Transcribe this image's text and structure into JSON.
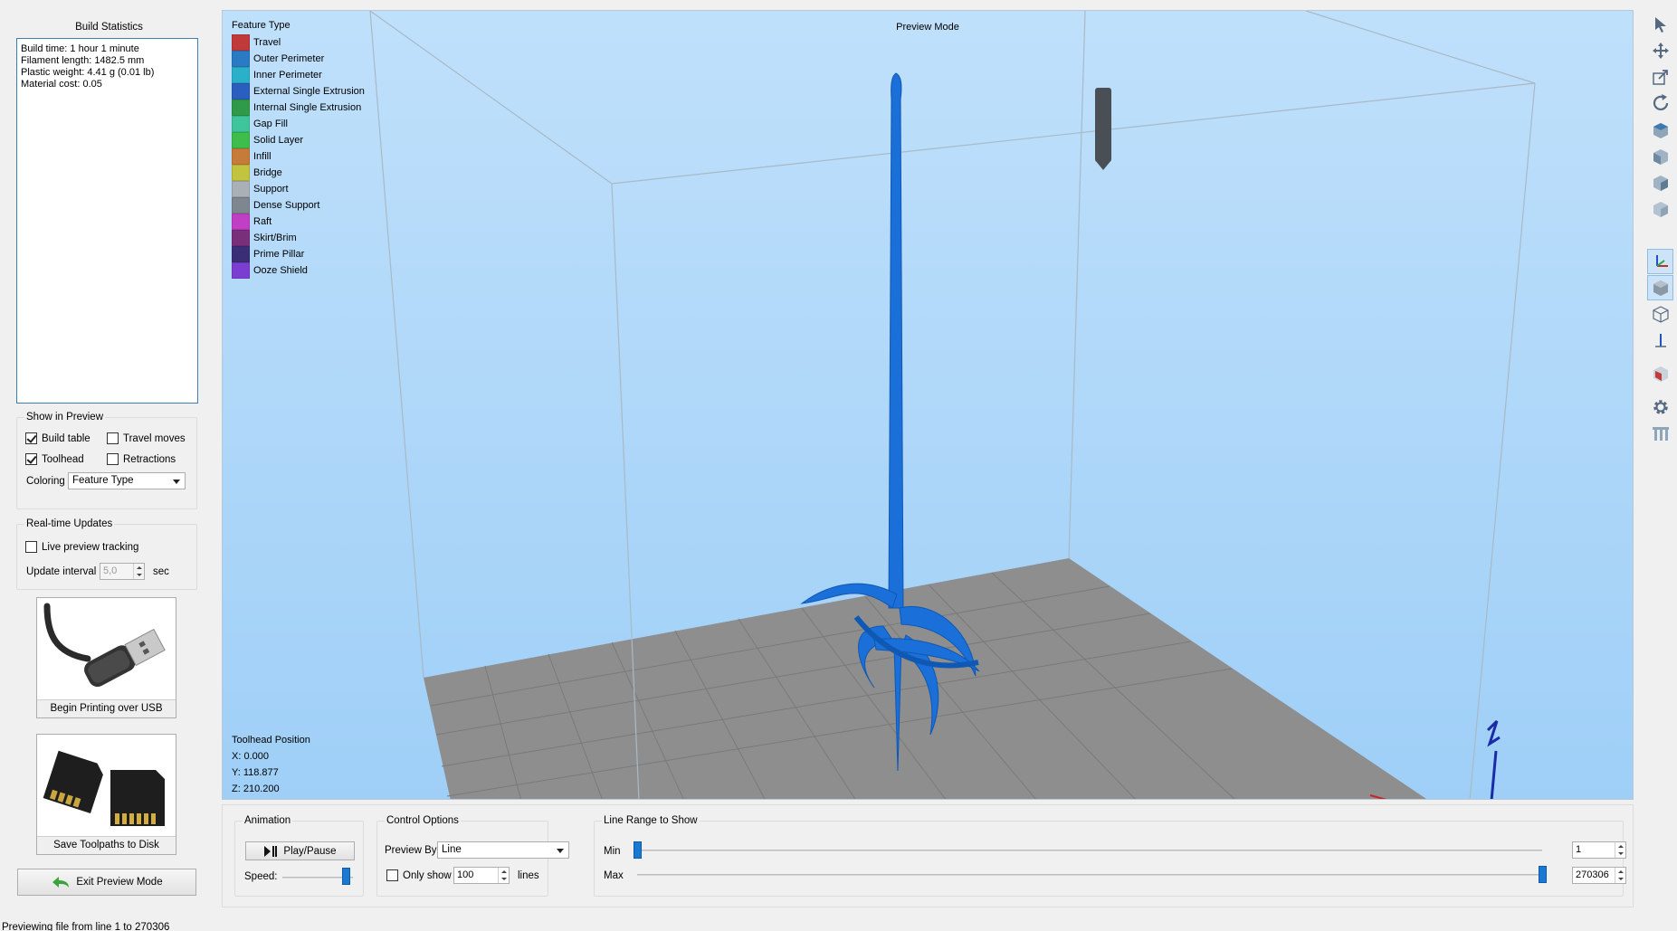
{
  "build_statistics": {
    "title": "Build Statistics",
    "lines": [
      "Build time: 1 hour 1 minute",
      "Filament length: 1482.5 mm",
      "Plastic weight: 4.41 g (0.01 lb)",
      "Material cost: 0.05"
    ]
  },
  "show_in_preview": {
    "title": "Show in Preview",
    "build_table": {
      "label": "Build table",
      "checked": true
    },
    "travel_moves": {
      "label": "Travel moves",
      "checked": false
    },
    "toolhead": {
      "label": "Toolhead",
      "checked": true
    },
    "retractions": {
      "label": "Retractions",
      "checked": false
    },
    "coloring_label": "Coloring",
    "coloring_value": "Feature Type"
  },
  "realtime_updates": {
    "title": "Real-time Updates",
    "live_tracking": {
      "label": "Live preview tracking",
      "checked": false
    },
    "interval_label": "Update interval",
    "interval_value": "5,0",
    "interval_unit": "sec"
  },
  "actions": {
    "usb_label": "Begin Printing over USB",
    "disk_label": "Save Toolpaths to Disk",
    "exit_label": "Exit Preview Mode"
  },
  "viewport": {
    "mode_label": "Preview Mode",
    "legend_title": "Feature Type",
    "legend": [
      {
        "label": "Travel",
        "color": "#c0393b"
      },
      {
        "label": "Outer Perimeter",
        "color": "#2a7ac4"
      },
      {
        "label": "Inner Perimeter",
        "color": "#2bb0c9"
      },
      {
        "label": "External Single Extrusion",
        "color": "#2a5fc0"
      },
      {
        "label": "Internal Single Extrusion",
        "color": "#2f9a47"
      },
      {
        "label": "Gap Fill",
        "color": "#3fc49b"
      },
      {
        "label": "Solid Layer",
        "color": "#3fbd4c"
      },
      {
        "label": "Infill",
        "color": "#c77b3a"
      },
      {
        "label": "Bridge",
        "color": "#c2c33e"
      },
      {
        "label": "Support",
        "color": "#a9b0b6"
      },
      {
        "label": "Dense Support",
        "color": "#7e8790"
      },
      {
        "label": "Raft",
        "color": "#c13fc4"
      },
      {
        "label": "Skirt/Brim",
        "color": "#7a2f7a"
      },
      {
        "label": "Prime Pillar",
        "color": "#3a2f77"
      },
      {
        "label": "Ooze Shield",
        "color": "#7a3fd0"
      }
    ],
    "toolhead_title": "Toolhead Position",
    "toolhead_x": "X: 0.000",
    "toolhead_y": "Y: 118.877",
    "toolhead_z": "Z: 210.200",
    "model_color": "#1a6fd9"
  },
  "toolbar": {
    "tools": [
      {
        "icon": "select-arrow-icon"
      },
      {
        "icon": "move-icon"
      },
      {
        "icon": "scale-icon"
      },
      {
        "icon": "rotate-icon"
      },
      {
        "icon": "view-cube-top-icon"
      },
      {
        "icon": "view-cube-front-icon"
      },
      {
        "icon": "view-cube-side-icon"
      },
      {
        "icon": "view-cube-iso-icon"
      },
      {
        "icon": "axes-icon"
      },
      {
        "icon": "solid-view-icon"
      },
      {
        "icon": "wireframe-view-icon"
      },
      {
        "icon": "z-axis-icon"
      },
      {
        "icon": "section-view-icon"
      },
      {
        "icon": "settings-gear-icon"
      },
      {
        "icon": "supports-icon"
      }
    ]
  },
  "animation": {
    "title": "Animation",
    "play_label": "Play/Pause",
    "speed_label": "Speed:",
    "speed_fraction": 0.9
  },
  "control_options": {
    "title": "Control Options",
    "preview_by_label": "Preview By",
    "preview_by_value": "Line",
    "only_show_label": "Only show",
    "only_show_checked": false,
    "only_show_value": "100",
    "only_show_unit": "lines"
  },
  "line_range": {
    "title": "Line Range to Show",
    "min_label": "Min",
    "max_label": "Max",
    "min_value": "1",
    "max_value": "270306",
    "min_fraction": 0.0,
    "max_fraction": 1.0
  },
  "status_bar": {
    "text": "Previewing file from line 1 to 270306"
  }
}
